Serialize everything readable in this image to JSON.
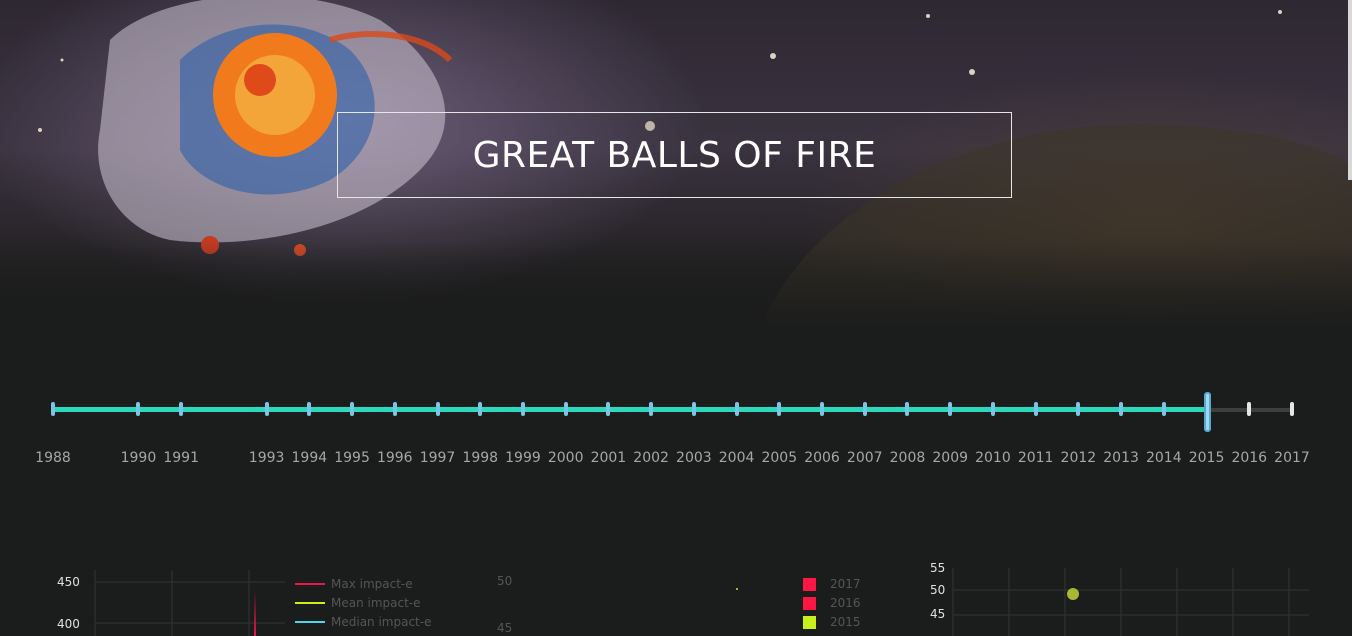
{
  "header": {
    "title": "GREAT BALLS OF FIRE"
  },
  "timeline": {
    "years": [
      "1988",
      "1990",
      "1991",
      "1993",
      "1994",
      "1995",
      "1996",
      "1997",
      "1998",
      "1999",
      "2000",
      "2001",
      "2002",
      "2003",
      "2004",
      "2005",
      "2006",
      "2007",
      "2008",
      "2009",
      "2010",
      "2011",
      "2012",
      "2013",
      "2014",
      "2015",
      "2016",
      "2017"
    ],
    "selected": "2015",
    "colors": {
      "fill": "#2bd9bd",
      "tick": "#7cc4e4",
      "inactive": "#e6e6e6"
    }
  },
  "chart_left": {
    "y_ticks": [
      "450",
      "400"
    ],
    "legend": [
      {
        "label": "Max impact-e",
        "color": "#e8174a"
      },
      {
        "label": "Mean impact-e",
        "color": "#c8f01a"
      },
      {
        "label": "Median impact-e",
        "color": "#4fd8e8"
      }
    ]
  },
  "chart_middle": {
    "y_ticks": [
      "50",
      "45"
    ],
    "legend": [
      {
        "label": "2017",
        "color": "#ff1744"
      },
      {
        "label": "2016",
        "color": "#ff1744"
      },
      {
        "label": "2015",
        "color": "#c8f01a"
      }
    ]
  },
  "chart_right": {
    "y_ticks": [
      "55",
      "50",
      "45"
    ],
    "point_color": "#a8b830"
  }
}
